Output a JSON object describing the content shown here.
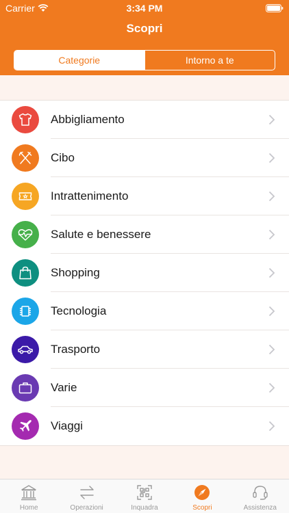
{
  "status": {
    "carrier": "Carrier",
    "time": "3:34 PM"
  },
  "nav": {
    "title": "Scopri"
  },
  "segments": [
    {
      "label": "Categorie",
      "active": true
    },
    {
      "label": "Intorno a te",
      "active": false
    }
  ],
  "categories": [
    {
      "label": "Abbigliamento",
      "icon": "tshirt-icon",
      "color": "#ea4a3f"
    },
    {
      "label": "Cibo",
      "icon": "fork-knife-icon",
      "color": "#f07a1f"
    },
    {
      "label": "Intrattenimento",
      "icon": "ticket-icon",
      "color": "#f6a623"
    },
    {
      "label": "Salute e benessere",
      "icon": "heart-pulse-icon",
      "color": "#46b04a"
    },
    {
      "label": "Shopping",
      "icon": "shopping-bag-icon",
      "color": "#0e8f80"
    },
    {
      "label": "Tecnologia",
      "icon": "chip-icon",
      "color": "#1ba6e8"
    },
    {
      "label": "Trasporto",
      "icon": "car-icon",
      "color": "#3b1aa8"
    },
    {
      "label": "Varie",
      "icon": "briefcase-icon",
      "color": "#6a3ab2"
    },
    {
      "label": "Viaggi",
      "icon": "airplane-icon",
      "color": "#a42ab0"
    }
  ],
  "tabs": [
    {
      "label": "Home",
      "icon": "bank-icon",
      "active": false
    },
    {
      "label": "Operazioni",
      "icon": "transfer-arrows-icon",
      "active": false
    },
    {
      "label": "Inquadra",
      "icon": "qr-code-icon",
      "active": false
    },
    {
      "label": "Scopri",
      "icon": "compass-icon",
      "active": true
    },
    {
      "label": "Assistenza",
      "icon": "headset-icon",
      "active": false
    }
  ],
  "colors": {
    "accent": "#f07a1f",
    "background": "#fdf3ee",
    "tab_inactive": "#9a9a9a"
  }
}
